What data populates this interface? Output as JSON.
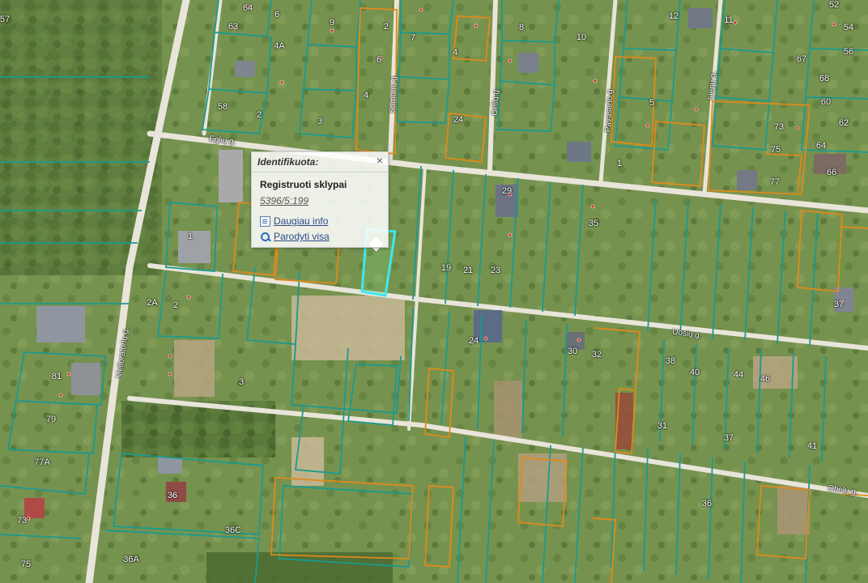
{
  "colors": {
    "registered_parcel": "#1b9a8f",
    "other_parcel": "#e08a1a",
    "selected_parcel": "#3fe8f0",
    "road": "#e8e4d8"
  },
  "popup": {
    "title": "Identifikuota:",
    "close_icon": "close-icon",
    "layer_name": "Registruoti sklypai",
    "parcel_id": "5396/5:199",
    "more_info_label": "Daugiau info",
    "show_all_label": "Parodyti visa"
  },
  "streets": {
    "eglu": "Eglių g.",
    "samanu": "Samanų g.",
    "gelu": "Gėlių g.",
    "pavasario": "Pavasario g.",
    "liepu": "Liepų g.",
    "melioratoriu": "Melioratorių g.",
    "uosiu": "Uosių g.",
    "obelu": "Obelų g."
  },
  "parcel_numbers": {
    "n64": "64",
    "n6": "6",
    "n9": "9",
    "n12": "12",
    "n52": "52",
    "n63": "63",
    "n4a": "4A",
    "n8": "8",
    "n2a": "2",
    "n10": "10",
    "n11": "11",
    "n54": "54",
    "n7a": "7",
    "n5": "5",
    "n4": "4",
    "n56": "56",
    "n6b": "6",
    "n58": "58",
    "n4b": "4",
    "n3": "3",
    "n2b": "2",
    "n24": "24",
    "n1a": "1",
    "n60": "60",
    "n62": "62",
    "n73": "73",
    "n75": "75",
    "n64b": "64",
    "n66": "66",
    "n77": "77",
    "n29": "29",
    "n35": "35",
    "n1b": "1",
    "n19": "19",
    "n21": "21",
    "n23": "23",
    "n2c": "2A",
    "n2d": "2",
    "n24b": "24",
    "n30": "30",
    "n32": "32",
    "n81": "81",
    "n79": "79",
    "n77a": "77A",
    "n36": "36",
    "n36c": "36C",
    "n36a": "36A",
    "n73b": "73",
    "n75b": "75",
    "n38": "38",
    "n40": "40",
    "n44": "44",
    "n46": "46",
    "n31": "31",
    "n37": "37",
    "n41": "41",
    "n37b": "37",
    "n3b": "3",
    "n36d": "36",
    "n57": "57",
    "n67": "67",
    "n68": "68"
  }
}
